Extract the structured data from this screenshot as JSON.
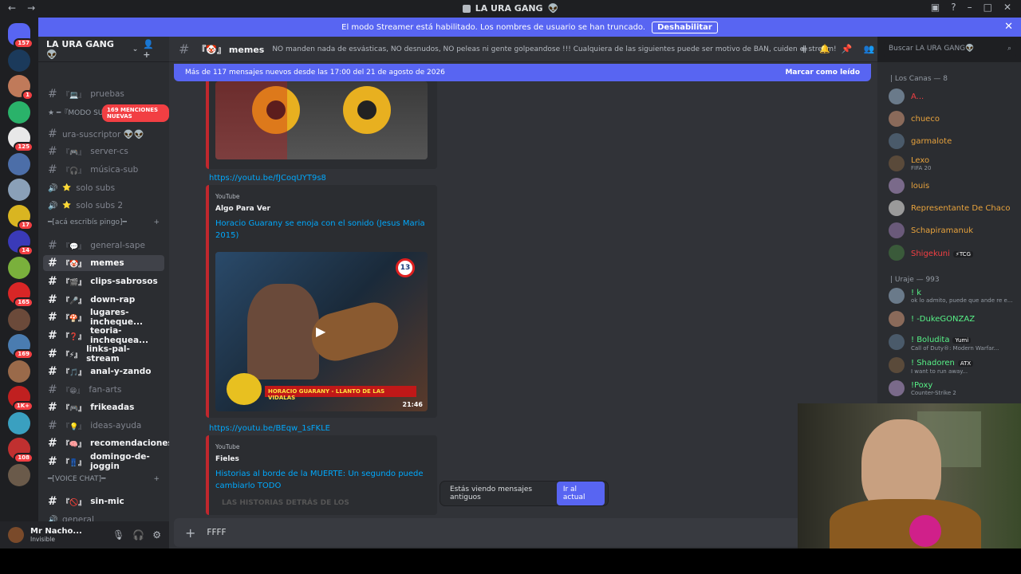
{
  "titlebar": {
    "title": "LA URA GANG",
    "emoji": "👽"
  },
  "banner": {
    "text": "El modo Streamer está habilitado. Los nombres de usuario se han truncado.",
    "button": "Deshabilitar"
  },
  "servers": [
    {
      "badge": "157",
      "color": "#5865f2"
    },
    {
      "badge": "",
      "color": "#1b3a5b"
    },
    {
      "badge": "1",
      "color": "#c07a5a"
    },
    {
      "badge": "",
      "color": "#2ab26a"
    },
    {
      "badge": "125",
      "color": "#e8e8e8"
    },
    {
      "badge": "",
      "color": "#4c6ea8"
    },
    {
      "badge": "",
      "color": "#8aa0b8"
    },
    {
      "badge": "17",
      "color": "#d9b521"
    },
    {
      "badge": "14",
      "color": "#3a3ab8"
    },
    {
      "badge": "",
      "color": "#7ab03c"
    },
    {
      "badge": "165",
      "color": "#d92626"
    },
    {
      "badge": "",
      "color": "#6b4a3a"
    },
    {
      "badge": "169",
      "color": "#4a7cb0"
    },
    {
      "badge": "",
      "color": "#9a6a4a"
    },
    {
      "badge": "1K+",
      "color": "#c02020"
    },
    {
      "badge": "",
      "color": "#3aa0c0"
    },
    {
      "badge": "108",
      "color": "#c03030"
    },
    {
      "badge": "",
      "color": "#6a5a4a"
    }
  ],
  "sidebar": {
    "guild_name": "LA URA GANG 👽",
    "mentions": "169 MENCIONES NUEVAS",
    "channels": [
      {
        "name": "pruebas",
        "icon": "『💻』",
        "type": "text",
        "unread": false
      },
      {
        "name": "ura-suscriptor 👽👽",
        "icon": "",
        "type": "text",
        "unread": false
      },
      {
        "name": "server-cs",
        "icon": "『🎮』",
        "type": "text",
        "unread": false
      },
      {
        "name": "música-sub",
        "icon": "『🎧』",
        "type": "text",
        "unread": false
      },
      {
        "name": "solo subs",
        "icon": "⭐",
        "type": "voice",
        "unread": false
      },
      {
        "name": "solo subs 2",
        "icon": "⭐",
        "type": "voice",
        "unread": false
      },
      {
        "name": "general-sape",
        "icon": "『💬』",
        "type": "text",
        "unread": false
      },
      {
        "name": "memes",
        "icon": "『🤡』",
        "type": "text",
        "unread": true,
        "selected": true
      },
      {
        "name": "clips-sabrosos",
        "icon": "『🎬』",
        "type": "text",
        "unread": true
      },
      {
        "name": "down-rap",
        "icon": "『🎤』",
        "type": "text",
        "unread": true
      },
      {
        "name": "lugares-incheque...",
        "icon": "『🍄』",
        "type": "text",
        "unread": true
      },
      {
        "name": "teoria-inchequea...",
        "icon": "『❓』",
        "type": "text",
        "unread": true
      },
      {
        "name": "links-pal-stream",
        "icon": "『⚡』",
        "type": "text",
        "unread": true
      },
      {
        "name": "anal-y-zando",
        "icon": "『🎵』",
        "type": "text",
        "unread": true
      },
      {
        "name": "fan-arts",
        "icon": "『😁』",
        "type": "text",
        "unread": false
      },
      {
        "name": "frikeadas",
        "icon": "『🎮』",
        "type": "text",
        "unread": true
      },
      {
        "name": "ideas-ayuda",
        "icon": "『💡』",
        "type": "text",
        "unread": false
      },
      {
        "name": "recomendaciones",
        "icon": "『🧠』",
        "type": "text",
        "unread": true
      },
      {
        "name": "domingo-de-joggin",
        "icon": "『👖』",
        "type": "text",
        "unread": true
      },
      {
        "name": "sin-mic",
        "icon": "『🚫』",
        "type": "text",
        "unread": true
      },
      {
        "name": "general",
        "icon": "",
        "type": "voice",
        "unread": false
      }
    ],
    "categories": [
      "★ ━『MODO SUB』━ ★",
      "━[acá escribís pingo]━",
      "━[VOICE CHAT]━"
    ]
  },
  "user": {
    "name": "Mr Nacho...",
    "status": "Invisible"
  },
  "channel": {
    "name": "『🤡』 memes",
    "topic": "NO manden nada de esvásticas, NO desnudos, NO peleas ni gente golpeandose !!! Cualquiera de las siguientes puede ser motivo de BAN, cuiden el stream!",
    "new_messages": "Más de 117 mensajes nuevos desde las 17:00 del 21 de agosto de 2026",
    "mark_read": "Marcar como leído"
  },
  "messages": [
    {
      "link": "https://youtu.be/fJCoqUYT9s8",
      "provider": "YouTube",
      "author": "Algo Para Ver",
      "title": "Horacio Guarany se enoja con el sonido (Jesus Maria 2015)",
      "duration": "21:46",
      "thumb_caption": "HORACIO GUARANY - LLANTO DE LAS VIDALAS"
    },
    {
      "link": "https://youtu.be/BEqw_1sFKLE",
      "provider": "YouTube",
      "author": "Fieles",
      "title": "Historias al borde de la MUERTE: Un segundo puede cambiarlo TODO",
      "thumb_caption": "LAS HISTORIAS DETRÁS DE LOS"
    }
  ],
  "oldbar": {
    "text": "Estás viendo mensajes antiguos",
    "button": "Ir al actual"
  },
  "composer": {
    "value": "FFFF"
  },
  "search": {
    "placeholder": "Buscar LA URA GANG👽"
  },
  "members": {
    "cat1": "| Los Canas — 8",
    "list1": [
      {
        "name": "A...",
        "sub": "",
        "color": "#f23f43"
      },
      {
        "name": "chueco",
        "sub": "",
        "color": "#e8a33d"
      },
      {
        "name": "garmalote",
        "sub": "",
        "color": "#e8a33d"
      },
      {
        "name": "Lexo",
        "sub": "FIFA 20",
        "color": "#e8a33d"
      },
      {
        "name": "louis",
        "sub": "",
        "color": "#e8a33d"
      },
      {
        "name": "Representante De Chaco",
        "sub": "",
        "color": "#e8a33d"
      },
      {
        "name": "Schapiramanuk",
        "sub": "",
        "color": "#e8a33d"
      },
      {
        "name": "Shigekuni",
        "sub": "",
        "color": "#f23f43",
        "tag": "⚡TCG"
      }
    ],
    "cat2": "| Uraje — 993",
    "list2": [
      {
        "name": "! k",
        "sub": "ok lo admito, puede que ande re e...",
        "color": "#57f287"
      },
      {
        "name": "! -DukeGONZAZ",
        "sub": "",
        "color": "#57f287"
      },
      {
        "name": "! Boludita",
        "sub": "Call of Duty®: Modern Warfar...",
        "color": "#57f287",
        "tag": "Yumi"
      },
      {
        "name": "! Shadoren",
        "sub": "I want to run away...",
        "color": "#57f287",
        "tag": "ATX"
      },
      {
        "name": "!Poxy",
        "sub": "Counter-Strike 2",
        "color": "#57f287"
      }
    ]
  }
}
